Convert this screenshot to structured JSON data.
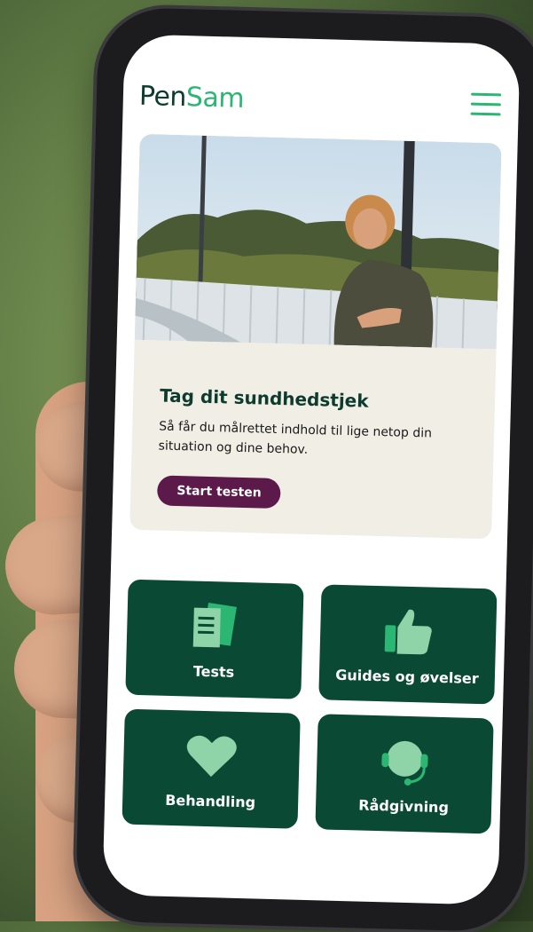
{
  "header": {
    "logo_part1": "Pen",
    "logo_part2": "Sam"
  },
  "hero": {
    "title": "Tag dit sundhedstjek",
    "text": "Så får du målrettet indhold til lige netop din situation og dine behov.",
    "button_label": "Start testen"
  },
  "tiles": [
    {
      "label": "Tests",
      "icon": "documents-icon"
    },
    {
      "label": "Guides og øvelser",
      "icon": "thumbs-up-icon"
    },
    {
      "label": "Behandling",
      "icon": "heart-icon"
    },
    {
      "label": "Rådgivning",
      "icon": "headset-icon"
    }
  ],
  "colors": {
    "brand_dark": "#0d3b2e",
    "brand_green": "#2bb673",
    "tile_bg": "#0a4a35",
    "tile_icon": "#8fd3a8",
    "button_bg": "#5c1a4a",
    "card_bg": "#f1eee6"
  }
}
